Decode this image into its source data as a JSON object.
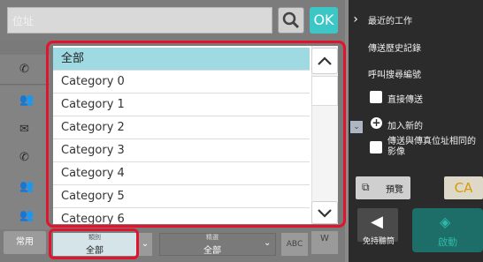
{
  "address_bar": {
    "label": "位址",
    "ok_label": "OK"
  },
  "right_menu": {
    "items": [
      "最近的工作",
      "傳送歷史記錄",
      "呼叫搜尋編號"
    ],
    "direct_send": "直接傳送",
    "add_new": "加入新的",
    "send_same_as_fax": "傳送與傳真位址相同的影像",
    "preview": "預覽",
    "ca": "CA",
    "speaker": "免持聽筒",
    "start": "啟動"
  },
  "dropdown": {
    "items": [
      "全部",
      "Category 0",
      "Category 1",
      "Category 2",
      "Category 3",
      "Category 4",
      "Category 5",
      "Category 6"
    ],
    "selected_index": 0
  },
  "bottom_bar": {
    "common": "常用",
    "category_title": "類別",
    "category_value": "全部",
    "filter_title": "精選",
    "filter_value": "全部",
    "abc": "ABC",
    "w": "W"
  },
  "colors": {
    "highlight": "#e2132c",
    "selected_row": "#9fd9e2",
    "ok": "#3cc6c6"
  }
}
